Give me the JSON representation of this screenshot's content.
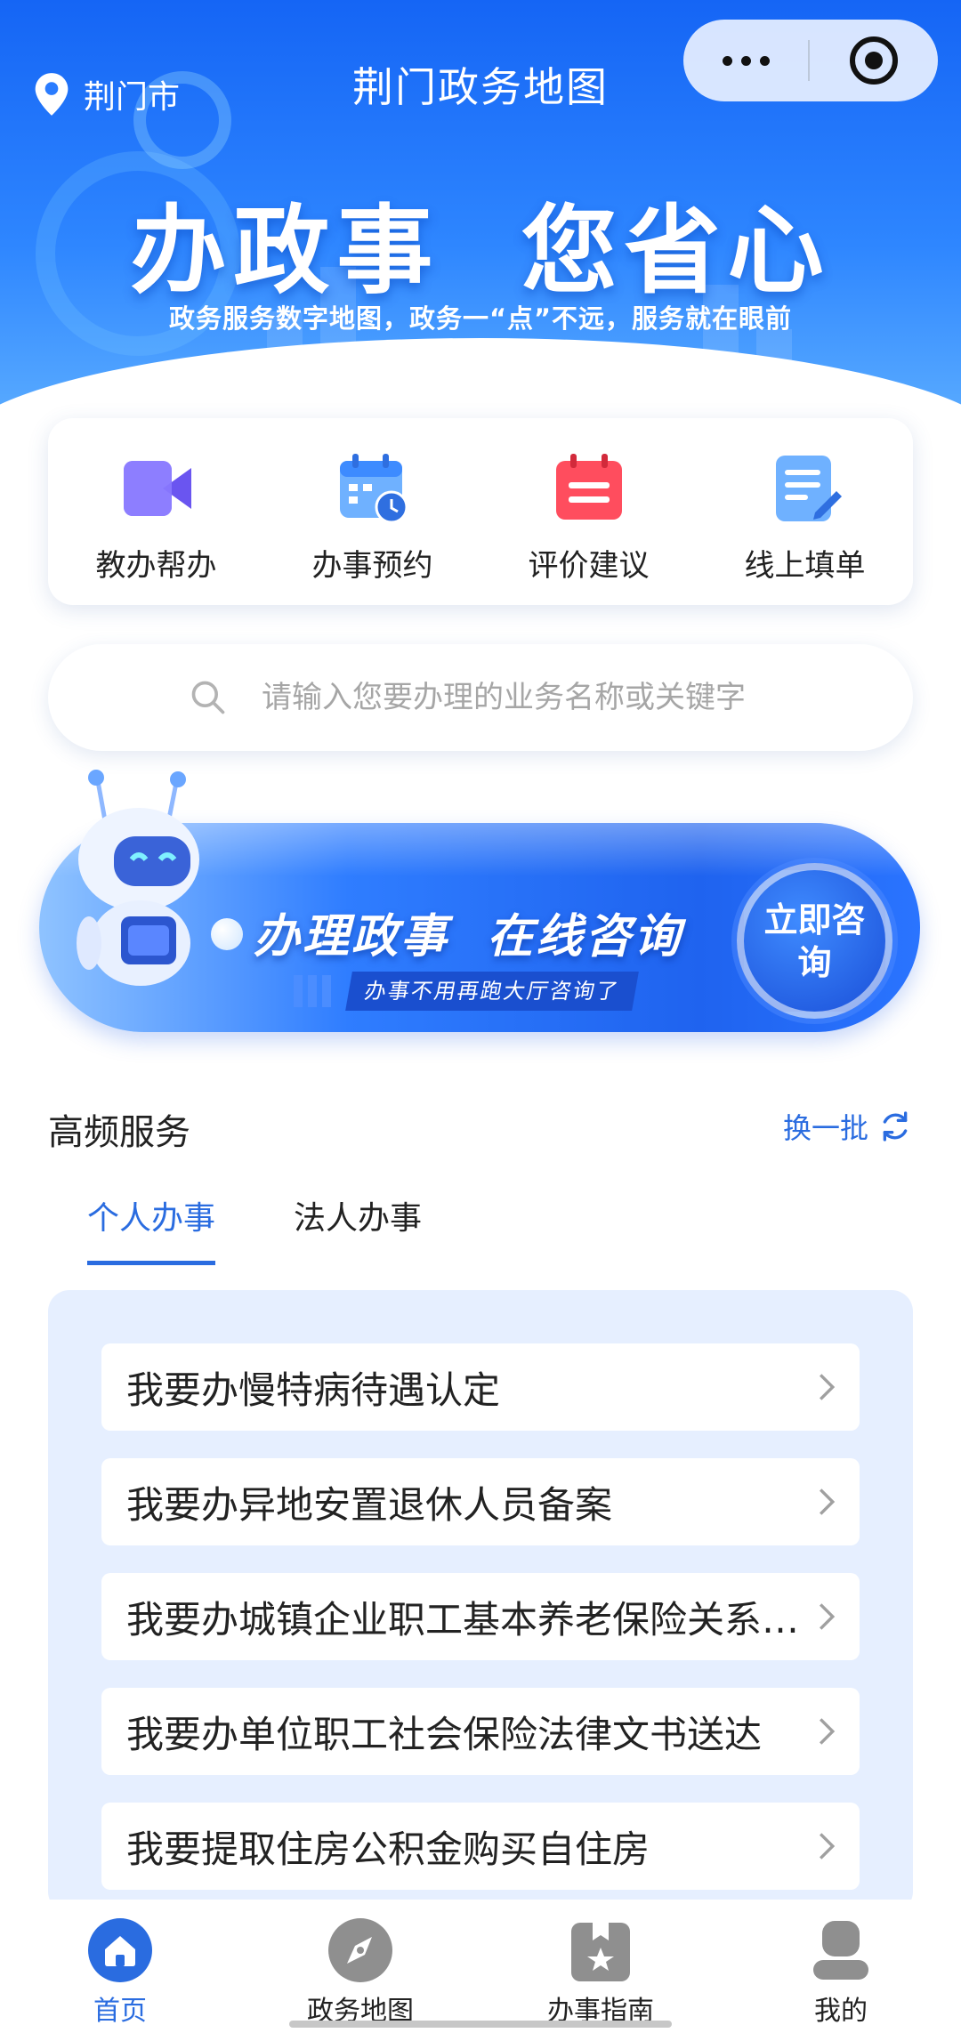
{
  "header": {
    "location": "荆门市",
    "title": "荆门政务地图"
  },
  "hero": {
    "slogan": "办政事  您省心",
    "subtitle": "政务服务数字地图，政务一“点”不远，服务就在眼前"
  },
  "quick_actions": [
    {
      "label": "教办帮办",
      "icon": "video-call-icon",
      "color": "#8b7bff"
    },
    {
      "label": "办事预约",
      "icon": "calendar-clock-icon",
      "color": "#4a9bff"
    },
    {
      "label": "评价建议",
      "icon": "rating-calendar-icon",
      "color": "#ff4d5e"
    },
    {
      "label": "线上填单",
      "icon": "form-edit-icon",
      "color": "#4a9bff"
    }
  ],
  "search": {
    "placeholder": "请输入您要办理的业务名称或关键字"
  },
  "banner": {
    "main_text": "办理政事  在线咨询",
    "sub_text": "办事不用再跑大厅咨询了",
    "cta": "立即咨询"
  },
  "high_freq": {
    "title": "高频服务",
    "refresh_label": "换一批",
    "tabs": [
      {
        "label": "个人办事",
        "active": true
      },
      {
        "label": "法人办事",
        "active": false
      }
    ],
    "items": [
      "我要办慢特病待遇认定",
      "我要办异地安置退休人员备案",
      "我要办城镇企业职工基本养老保险关系转移",
      "我要办单位职工社会保险法律文书送达",
      "我要提取住房公积金购买自住房"
    ]
  },
  "tabbar": [
    {
      "label": "首页",
      "icon": "home-icon",
      "active": true
    },
    {
      "label": "政务地图",
      "icon": "compass-icon",
      "active": false
    },
    {
      "label": "办事指南",
      "icon": "guide-book-icon",
      "active": false
    },
    {
      "label": "我的",
      "icon": "user-icon",
      "active": false
    }
  ],
  "colors": {
    "brand": "#2a6ce0",
    "hero_top": "#1565f5",
    "panel_bg": "#e6efff"
  }
}
